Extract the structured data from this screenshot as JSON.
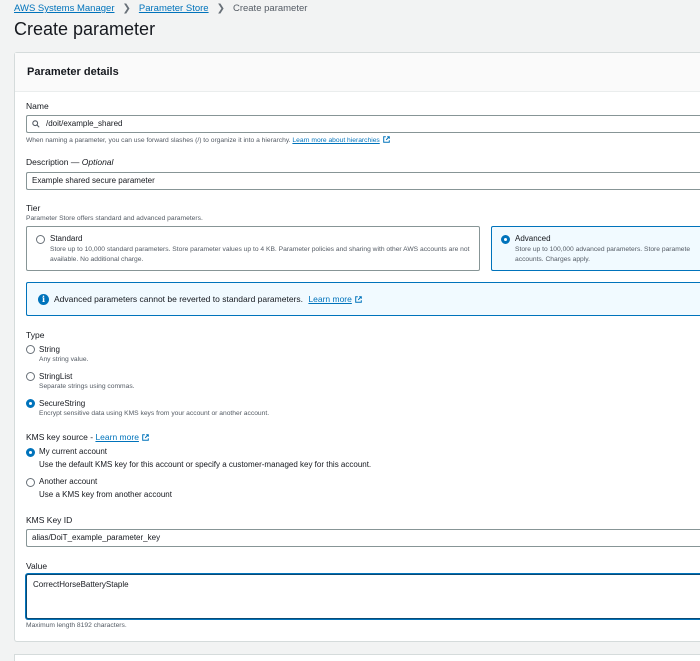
{
  "breadcrumb": {
    "items": [
      "AWS Systems Manager",
      "Parameter Store"
    ],
    "current": "Create parameter"
  },
  "page_title": "Create parameter",
  "panel": {
    "title": "Parameter details",
    "name": {
      "label": "Name",
      "value": "/doit/example_shared",
      "hint": "When naming a parameter, you can use forward slashes (/) to organize it into a hierarchy.",
      "hint_link": "Learn more about hierarchies"
    },
    "description": {
      "label": "Description —",
      "optional": "Optional",
      "value": "Example shared secure parameter"
    },
    "tier": {
      "label": "Tier",
      "hint": "Parameter Store offers standard and advanced parameters.",
      "options": [
        {
          "title": "Standard",
          "desc": "Store up to 10,000 standard parameters. Store parameter values up to 4 KB. Parameter policies and sharing with other AWS accounts are not available. No additional charge.",
          "selected": false
        },
        {
          "title": "Advanced",
          "desc_line1": "Store up to 100,000 advanced parameters. Store paramete",
          "desc_line2": "accounts. Charges apply.",
          "selected": true
        }
      ]
    },
    "alert": {
      "text": "Advanced parameters cannot be reverted to standard parameters.",
      "link": "Learn more"
    },
    "type": {
      "label": "Type",
      "options": [
        {
          "title": "String",
          "desc": "Any string value.",
          "selected": false
        },
        {
          "title": "StringList",
          "desc": "Separate strings using commas.",
          "selected": false
        },
        {
          "title": "SecureString",
          "desc": "Encrypt sensitive data using KMS keys from your account or another account.",
          "selected": true
        }
      ]
    },
    "kms_source": {
      "label": "KMS key source -",
      "link": "Learn more",
      "options": [
        {
          "title": "My current account",
          "desc": "Use the default KMS key for this account or specify a customer-managed key for this account.",
          "selected": true
        },
        {
          "title": "Another account",
          "desc": "Use a KMS key from another account",
          "selected": false
        }
      ]
    },
    "kms_key_id": {
      "label": "KMS Key ID",
      "value": "alias/DoiT_example_parameter_key"
    },
    "value": {
      "label": "Value",
      "value": "CorrectHorseBatteryStaple",
      "hint": "Maximum length 8192 characters."
    }
  },
  "colors": {
    "link": "#0073bb",
    "selected": "#0073bb",
    "background": "#f2f3f3"
  }
}
